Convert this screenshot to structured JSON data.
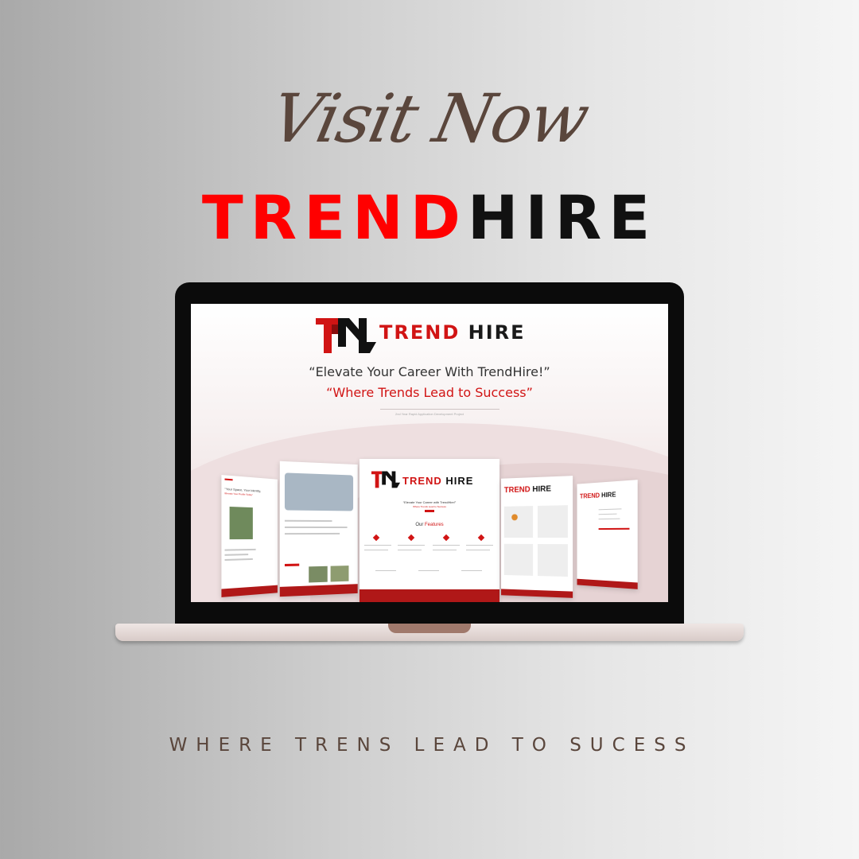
{
  "heading": {
    "script": "Visit Now",
    "brand_red": "TREND",
    "brand_black": "HIRE"
  },
  "screen": {
    "brand_red": "TREND",
    "brand_black": "HIRE",
    "quote_main": "“Elevate Your Career With TrendHire!”",
    "quote_sub": "“Where Trends Lead to Success”",
    "project_note": "2nd Year Rapid Application Development Project",
    "card_center": {
      "brand_red": "TREND",
      "brand_black": "HIRE",
      "quote": "“Elevate Your Career with TrendHire!”",
      "sub": "Where Trends Lead to Success",
      "features_prefix": "Our",
      "features_highlight": "Features"
    },
    "card_left": {
      "heading": "“Your Space, Your Identity,",
      "subheading": "Elevate Your Profile Today”"
    },
    "card_right": {
      "brand_red": "TREND",
      "brand_black": "HIRE"
    },
    "card_far_right": {
      "brand_red": "TREND",
      "brand_black": "HIRE"
    }
  },
  "tagline": "WHERE TRENS LEAD TO SUCESS",
  "colors": {
    "brand_red": "#ff0000",
    "dark": "#111111",
    "accent_brown": "#5a463c",
    "site_red": "#d11414"
  }
}
